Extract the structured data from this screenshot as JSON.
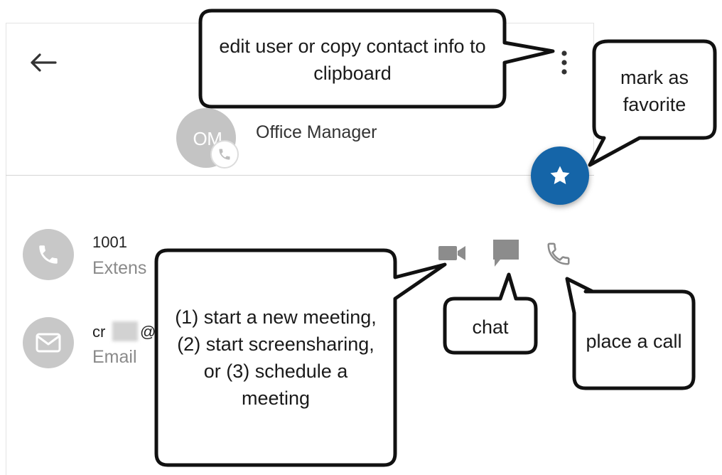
{
  "header": {
    "back_icon": "arrow-left-icon",
    "more_icon": "more-vertical-icon"
  },
  "contact": {
    "initials": "OM",
    "name": "Office Manager",
    "badge_icon": "phone-icon",
    "favorite_icon": "star-icon",
    "accent_color": "#1565a8"
  },
  "details": [
    {
      "icon": "phone-icon",
      "primary": "1001",
      "secondary": "Extens"
    },
    {
      "icon": "mail-icon",
      "primary": "cr",
      "primary_suffix": "@",
      "secondary": "Email"
    }
  ],
  "actions": [
    {
      "icon": "video-icon"
    },
    {
      "icon": "chat-icon"
    },
    {
      "icon": "phone-icon"
    }
  ],
  "callouts": {
    "more": "edit user or copy contact info to clipboard",
    "favorite": "mark as favorite",
    "video": "(1) start a new meeting, (2) start screensharing, or (3) schedule a meeting",
    "chat": "chat",
    "call": "place a call"
  }
}
